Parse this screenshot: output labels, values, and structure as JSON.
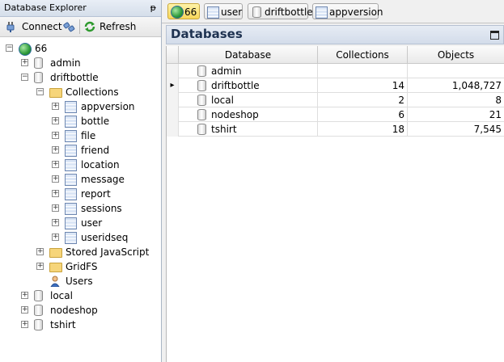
{
  "explorer": {
    "title": "Database Explorer",
    "pin_glyph": "ᵽ",
    "toolbar": {
      "connect_label": "Connect",
      "refresh_label": "Refresh"
    },
    "tree": {
      "server": "66",
      "databases": [
        "admin",
        "driftbottle",
        "local",
        "nodeshop",
        "tshirt"
      ],
      "collections_label": "Collections",
      "collections": [
        "appversion",
        "bottle",
        "file",
        "friend",
        "location",
        "message",
        "report",
        "sessions",
        "user",
        "useridseq"
      ],
      "stored_js_label": "Stored JavaScript",
      "gridfs_label": "GridFS",
      "users_label": "Users"
    }
  },
  "tabs": [
    {
      "label": "66",
      "icon": "globe-icon",
      "active": true
    },
    {
      "label": "user",
      "icon": "collection-icon",
      "active": false
    },
    {
      "label": "driftbottle",
      "icon": "database-icon",
      "active": false
    },
    {
      "label": "appversion",
      "icon": "collection-icon",
      "active": false
    }
  ],
  "panel": {
    "title": "Databases"
  },
  "grid": {
    "columns": [
      "Database",
      "Collections",
      "Objects"
    ],
    "rows": [
      {
        "database": "admin",
        "collections": "",
        "objects": "",
        "selected": false
      },
      {
        "database": "driftbottle",
        "collections": "14",
        "objects": "1,048,727",
        "selected": true
      },
      {
        "database": "local",
        "collections": "2",
        "objects": "8",
        "selected": false
      },
      {
        "database": "nodeshop",
        "collections": "6",
        "objects": "21",
        "selected": false
      },
      {
        "database": "tshirt",
        "collections": "18",
        "objects": "7,545",
        "selected": false
      }
    ],
    "row_pointer": "▸"
  }
}
